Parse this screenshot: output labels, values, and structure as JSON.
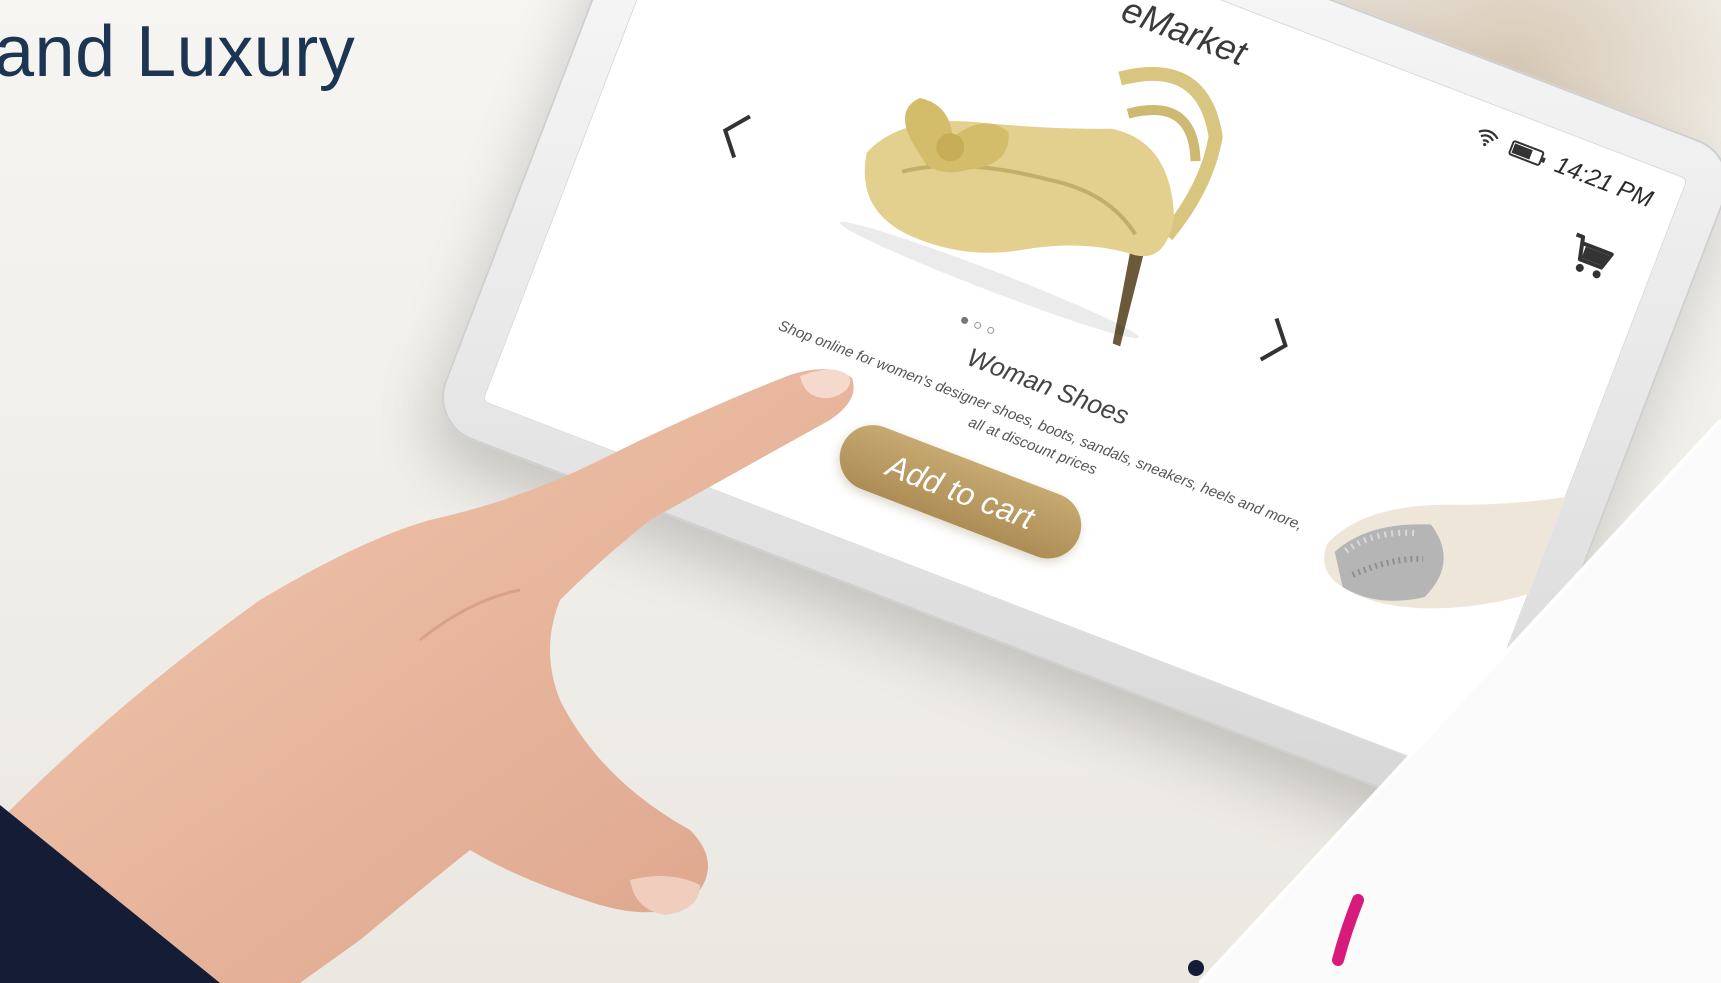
{
  "page": {
    "heading": "and Luxury"
  },
  "tablet": {
    "status": {
      "time": "14:21 PM",
      "wifi_icon": "wifi-icon",
      "battery_icon": "battery-icon"
    },
    "app": {
      "title": "eMarket",
      "cart_icon": "cart-icon"
    },
    "carousel": {
      "prev_icon": "chevron-left-icon",
      "next_icon": "chevron-right-icon",
      "dots_total": 3,
      "dots_active": 1
    },
    "product": {
      "name": "Woman Shoes",
      "description": "Shop online for women's designer shoes, boots, sandals, sneakers, heels and more, all at discount prices",
      "add_to_cart_label": "Add to cart",
      "button_color": "#b89a60",
      "shoe_color": "#e3d08e"
    }
  },
  "colors": {
    "heading": "#1b3553",
    "navy_accent": "#151c36",
    "pink_accent": "#d81b7a"
  }
}
